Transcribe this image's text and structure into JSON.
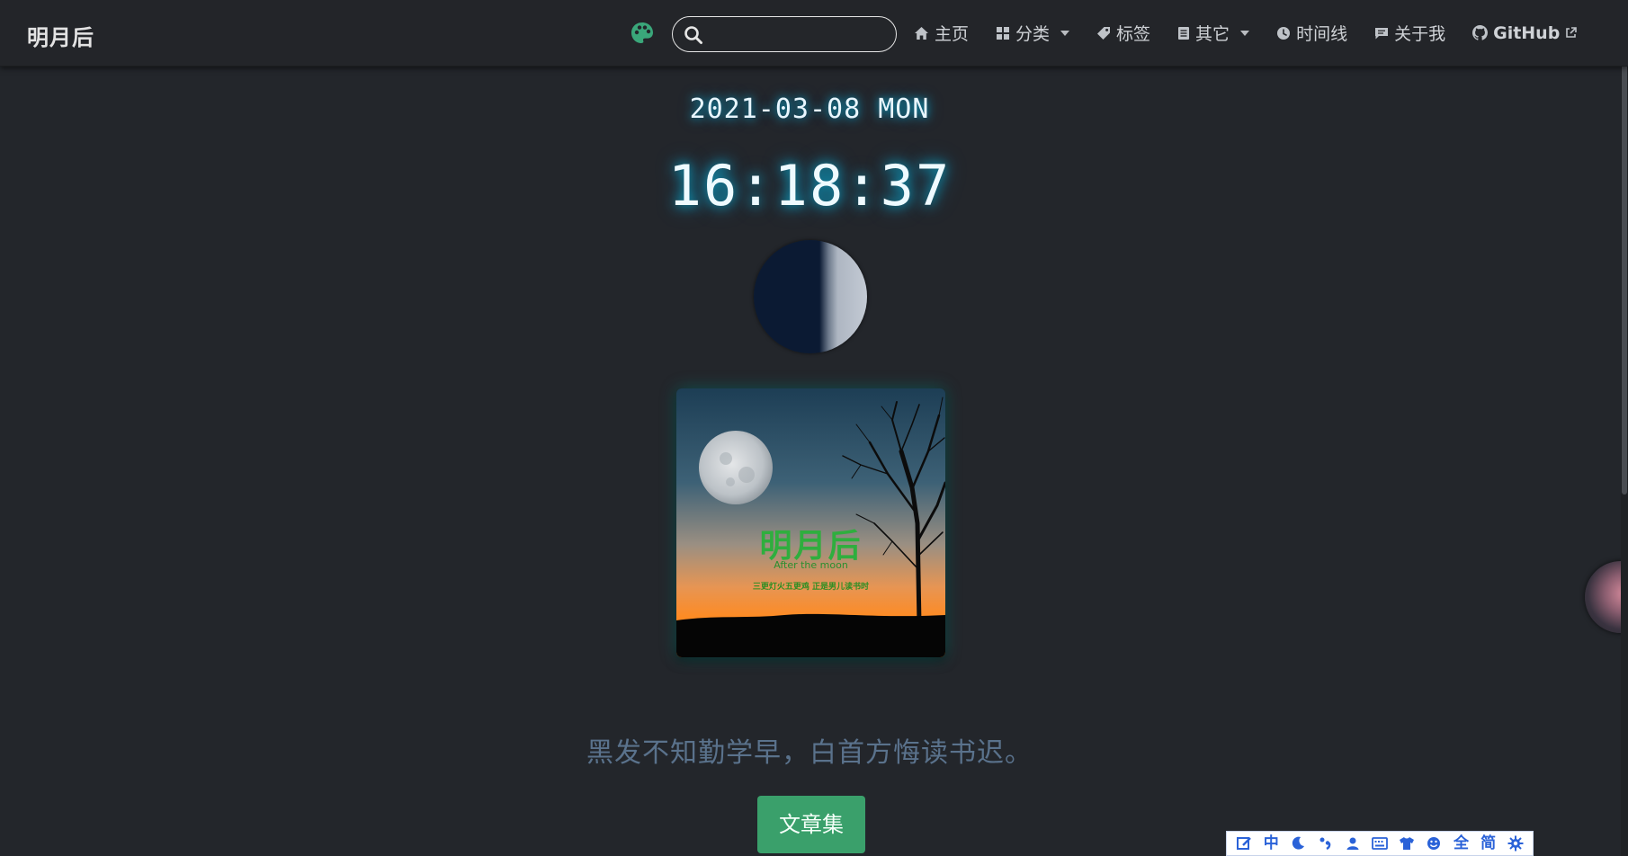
{
  "brand": "明月后",
  "search": {
    "value": "",
    "placeholder": ""
  },
  "nav": {
    "home": "主页",
    "categories": "分类",
    "tags": "标签",
    "other": "其它",
    "timeline": "时间线",
    "about": "关于我",
    "github": "GitHub"
  },
  "clock": {
    "date": "2021-03-08 MON",
    "time": "16:18:37"
  },
  "logo": {
    "title": "明月后",
    "subtitle": "After the moon",
    "poem": "三更灯火五更鸡 正是男儿读书时"
  },
  "quote": "黑发不知勤学早，白首方悔读书迟。",
  "articles_button": "文章集",
  "ime": {
    "items": [
      "中",
      "全",
      "简"
    ]
  },
  "colors": {
    "background": "#23262b",
    "accent_green": "#3aa06b",
    "glow_cyan": "#00d2ff",
    "quote_blue": "#5a728c",
    "ime_blue": "#2a62d8"
  },
  "icons": [
    "palette-icon",
    "search-icon",
    "home-icon",
    "grid-icon",
    "tag-icon",
    "book-icon",
    "clock-icon",
    "message-icon",
    "github-icon",
    "external-link-icon"
  ]
}
